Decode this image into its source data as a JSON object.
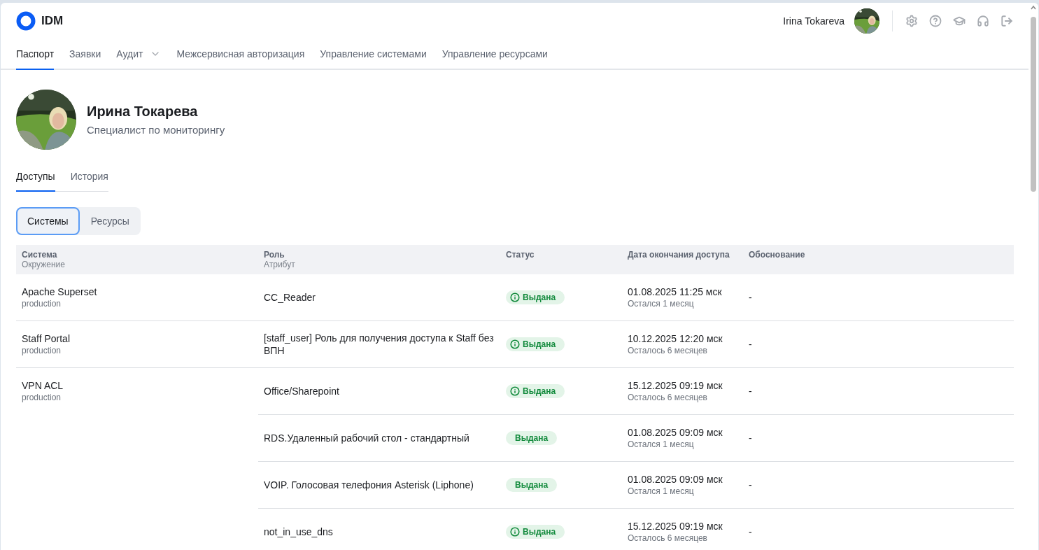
{
  "header": {
    "logo": "IDM",
    "user_name": "Irina Tokareva"
  },
  "nav": [
    {
      "label": "Паспорт",
      "selected": true,
      "dropdown": false
    },
    {
      "label": "Заявки",
      "selected": false,
      "dropdown": false
    },
    {
      "label": "Аудит",
      "selected": false,
      "dropdown": true
    },
    {
      "label": "Межсервисная авторизация",
      "selected": false,
      "dropdown": false
    },
    {
      "label": "Управление системами",
      "selected": false,
      "dropdown": false
    },
    {
      "label": "Управление ресурсами",
      "selected": false,
      "dropdown": false
    }
  ],
  "profile": {
    "name": "Ирина Токарева",
    "position": "Специалист по мониторингу"
  },
  "tabs": [
    {
      "label": "Доступы",
      "selected": true
    },
    {
      "label": "История",
      "selected": false
    }
  ],
  "segments": [
    {
      "label": "Системы",
      "selected": true
    },
    {
      "label": "Ресурсы",
      "selected": false
    }
  ],
  "table": {
    "columns": [
      {
        "title": "Система",
        "subtitle": "Окружение"
      },
      {
        "title": "Роль",
        "subtitle": "Атрибут"
      },
      {
        "title": "Статус"
      },
      {
        "title": "Дата окончания доступа"
      },
      {
        "title": "Обоснование"
      }
    ],
    "groups": [
      {
        "system": "Apache Superset",
        "environment": "production",
        "roles": [
          {
            "role": "CC_Reader",
            "status": "Выдана",
            "info_icon": true,
            "date": "01.08.2025 11:25 мск",
            "remaining": "Остался 1 месяц",
            "reason": "-"
          }
        ]
      },
      {
        "system": "Staff Portal",
        "environment": "production",
        "roles": [
          {
            "role": "[staff_user] Роль для получения доступа к Staff без ВПН",
            "status": "Выдана",
            "info_icon": true,
            "date": "10.12.2025 12:20 мск",
            "remaining": "Осталось 6 месяцев",
            "reason": "-"
          }
        ]
      },
      {
        "system": "VPN ACL",
        "environment": "production",
        "roles": [
          {
            "role": "Office/Sharepoint",
            "status": "Выдана",
            "info_icon": true,
            "date": "15.12.2025 09:19 мск",
            "remaining": "Осталось 6 месяцев",
            "reason": "-"
          },
          {
            "role": "RDS.Удаленный рабочий стол - стандартный",
            "status": "Выдана",
            "info_icon": false,
            "date": "01.08.2025 09:09 мск",
            "remaining": "Остался 1 месяц",
            "reason": "-"
          },
          {
            "role": "VOIP. Голосовая телефония Asterisk (Liphone)",
            "status": "Выдана",
            "info_icon": false,
            "date": "01.08.2025 09:09 мск",
            "remaining": "Остался 1 месяц",
            "reason": "-"
          },
          {
            "role": "not_in_use_dns",
            "status": "Выдана",
            "info_icon": true,
            "date": "15.12.2025 09:19 мск",
            "remaining": "Осталось 6 месяцев",
            "reason": "-"
          }
        ]
      }
    ]
  }
}
